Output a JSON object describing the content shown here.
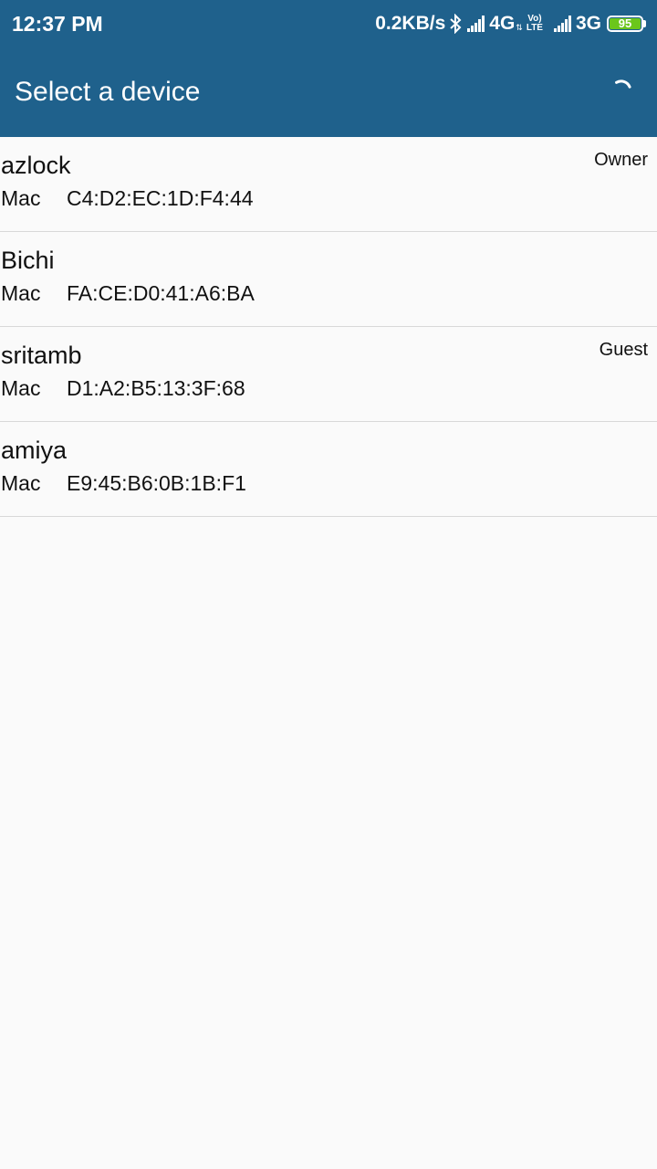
{
  "status_bar": {
    "time": "12:37 PM",
    "speed": "0.2KB/s",
    "network1": "4G",
    "volte_top": "Vo)",
    "volte_bottom": "LTE",
    "network2": "3G",
    "battery": "95",
    "icons": [
      "bluetooth-icon",
      "signal-icon",
      "volte-icon",
      "battery-icon"
    ],
    "battery_color": "#6bc61b"
  },
  "app_bar": {
    "title": "Select a device",
    "background": "#1f618c",
    "loading_icon": "spinner-icon"
  },
  "devices": [
    {
      "name": "azlock",
      "mac_label": "Mac",
      "mac": "C4:D2:EC:1D:F4:44",
      "role": "Owner"
    },
    {
      "name": "Bichi",
      "mac_label": "Mac",
      "mac": "FA:CE:D0:41:A6:BA",
      "role": ""
    },
    {
      "name": "sritamb",
      "mac_label": "Mac",
      "mac": "D1:A2:B5:13:3F:68",
      "role": "Guest"
    },
    {
      "name": "amiya",
      "mac_label": "Mac",
      "mac": "E9:45:B6:0B:1B:F1",
      "role": ""
    }
  ]
}
